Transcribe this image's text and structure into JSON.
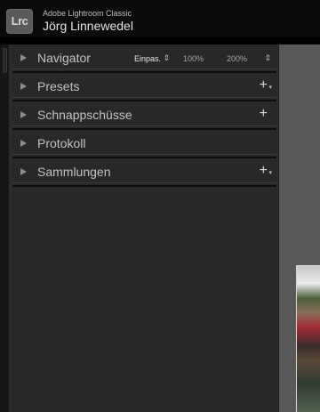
{
  "app": {
    "logo_text": "Lrc",
    "product_name": "Adobe Lightroom Classic",
    "user_name": "Jörg Linnewedel"
  },
  "left_panel": {
    "sections": [
      {
        "title": "Navigator",
        "expanded": false,
        "options": {
          "fit": "Einpas.",
          "zoom_1": "100%",
          "zoom_2": "200%"
        }
      },
      {
        "title": "Presets",
        "expanded": false,
        "add": "+"
      },
      {
        "title": "Schnappschüsse",
        "expanded": false,
        "add": "+"
      },
      {
        "title": "Protokoll",
        "expanded": false
      },
      {
        "title": "Sammlungen",
        "expanded": false,
        "add": "+"
      }
    ]
  },
  "colors": {
    "panel_bg": "#282828",
    "app_bg": "#000000",
    "content_bg": "#595959",
    "text": "#c2c2c2"
  }
}
